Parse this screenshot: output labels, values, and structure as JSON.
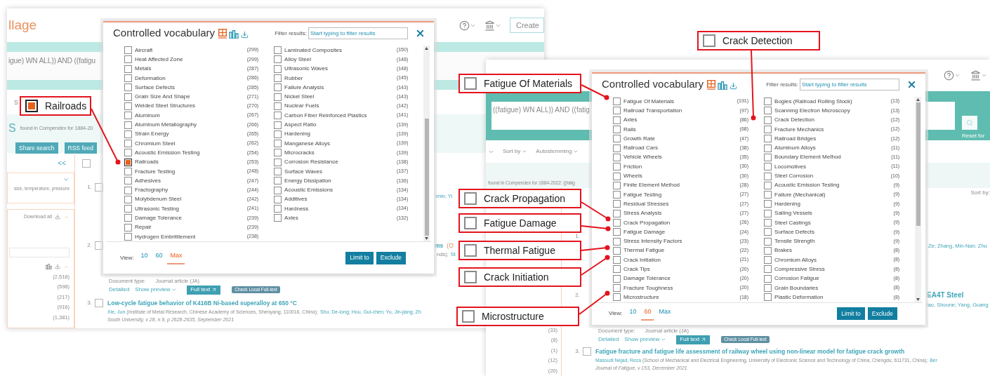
{
  "left_screenshot": {
    "header": {
      "logo": "llage",
      "button": "Create"
    },
    "query": "igue) WN ALL)) AND ((fatigu",
    "sort_fragment": "S",
    "summary": {
      "count": "S",
      "text": "found in Compendex for 1884-20"
    },
    "actions": [
      "Share search",
      "RSS feed"
    ],
    "sidebar": {
      "collapse": "<<",
      "facet_hint": "size, temperature, pressure",
      "download_all": "Download all",
      "counts": [
        "(2,518)",
        "(598)",
        "(217)",
        "(916)",
        "(1,381)"
      ]
    },
    "select_all_checked": false,
    "result1": {
      "number": "1.",
      "checked": false,
      "authors_fragment": "imin; Yi"
    },
    "result2": {
      "number": "2.",
      "checked": false,
      "title_fragment": "ms",
      "title_suffix": "(O",
      "authors_fragment": "nds);",
      "author_link": "St"
    },
    "record": {
      "doc_type_label": "Document type:",
      "doc_type": "Journal article (JA)",
      "detailed": "Detailed",
      "preview": "Show preview",
      "full_text": "Full text",
      "local": "Check Local Full-text"
    },
    "result3": {
      "number": "3.",
      "checked": false,
      "title": "Low-cycle fatigue behavior of K416B Ni-based superalloy at 650 °C",
      "author": "Xie, Jun",
      "affiliation": "(Institute of Metal Research, Chinese Academy of Sciences, Shenyang; 110016, China);",
      "coauthors": "Shu, De-long; Hou, Gui-chen; Yu, Jin-jiang; Zh",
      "source": "South University, v 28, n 9, p 2628-2635, September 2021"
    },
    "dialog": {
      "title": "Controlled vocabulary",
      "filter_label": "Filter results:",
      "filter_placeholder": "Start typing to filter results",
      "columns": [
        {
          "items": [
            {
              "label": "Aircraft",
              "count": "(299)",
              "checked": false
            },
            {
              "label": "Heat Affected Zone",
              "count": "(299)",
              "checked": false
            },
            {
              "label": "Metals",
              "count": "(287)",
              "checked": false
            },
            {
              "label": "Deformation",
              "count": "(286)",
              "checked": false
            },
            {
              "label": "Surface Defects",
              "count": "(285)",
              "checked": false
            },
            {
              "label": "Grain Size And Shape",
              "count": "(271)",
              "checked": false
            },
            {
              "label": "Welded Steel Structures",
              "count": "(270)",
              "checked": false
            },
            {
              "label": "Aluminum",
              "count": "(267)",
              "checked": false
            },
            {
              "label": "Aluminum Metallography",
              "count": "(266)",
              "checked": false
            },
            {
              "label": "Strain Energy",
              "count": "(265)",
              "checked": false
            },
            {
              "label": "Chromium Steel",
              "count": "(262)",
              "checked": false
            },
            {
              "label": "Acoustic Emission Testing",
              "count": "(254)",
              "checked": false
            },
            {
              "label": "Railroads",
              "count": "(253)",
              "checked": true
            },
            {
              "label": "Fracture Testing",
              "count": "(248)",
              "checked": false
            },
            {
              "label": "Adhesives",
              "count": "(247)",
              "checked": false
            },
            {
              "label": "Fractography",
              "count": "(244)",
              "checked": false
            },
            {
              "label": "Molybdenum Steel",
              "count": "(242)",
              "checked": false
            },
            {
              "label": "Ultrasonic Testing",
              "count": "(241)",
              "checked": false
            },
            {
              "label": "Damage Tolerance",
              "count": "(239)",
              "checked": false
            },
            {
              "label": "Repair",
              "count": "(239)",
              "checked": false
            },
            {
              "label": "Hydrogen Embrittlement",
              "count": "(238)",
              "checked": false
            }
          ]
        },
        {
          "items": [
            {
              "label": "Laminated Composites",
              "count": "(150)",
              "checked": false
            },
            {
              "label": "Alloy Steel",
              "count": "(148)",
              "checked": false
            },
            {
              "label": "Ultrasonic Waves",
              "count": "(148)",
              "checked": false
            },
            {
              "label": "Rubber",
              "count": "(145)",
              "checked": false
            },
            {
              "label": "Failure Analysis",
              "count": "(143)",
              "checked": false
            },
            {
              "label": "Nickel Steel",
              "count": "(143)",
              "checked": false
            },
            {
              "label": "Nuclear Fuels",
              "count": "(142)",
              "checked": false
            },
            {
              "label": "Carbon Fiber Reinforced Plastics",
              "count": "(141)",
              "checked": false
            },
            {
              "label": "Aspect Ratio",
              "count": "(139)",
              "checked": false
            },
            {
              "label": "Hardening",
              "count": "(139)",
              "checked": false
            },
            {
              "label": "Manganese Alloys",
              "count": "(139)",
              "checked": false
            },
            {
              "label": "Microcracks",
              "count": "(139)",
              "checked": false
            },
            {
              "label": "Corrosion Resistance",
              "count": "(138)",
              "checked": false
            },
            {
              "label": "Surface Waves",
              "count": "(137)",
              "checked": false
            },
            {
              "label": "Energy Dissipation",
              "count": "(136)",
              "checked": false
            },
            {
              "label": "Acoustic Emissions",
              "count": "(134)",
              "checked": false
            },
            {
              "label": "Additives",
              "count": "(134)",
              "checked": false
            },
            {
              "label": "Hardness",
              "count": "(134)",
              "checked": false
            },
            {
              "label": "Axles",
              "count": "(132)",
              "checked": false
            }
          ]
        }
      ],
      "view": {
        "label": "View:",
        "options": [
          {
            "label": "10",
            "selected": false
          },
          {
            "label": "60",
            "selected": false
          },
          {
            "label": "Max",
            "selected": true
          }
        ]
      },
      "buttons": [
        "Limit to",
        "Exclude"
      ]
    }
  },
  "right_screenshot": {
    "query": "((fatigue) WN ALL)) AND ((fatig",
    "reset": "Reset for",
    "toolbar": [
      "Sort by",
      "Autostemming"
    ],
    "summary": "found in Compendex for 1884-2022: ((fatig",
    "sort_label": "Sort by:",
    "sidebar_counts": [
      "(33)",
      "(8)",
      "(1)",
      "(12)",
      "(20)"
    ],
    "result1": {
      "number": "1.",
      "authors_fragment": "Ze; Zhang, Min-Nan; Zhu"
    },
    "result2": {
      "number": "2.",
      "title_fragment": "EA4T Steel",
      "authors_fragment": "iao, Shoune; Yang, Guang"
    },
    "record": {
      "doc_type_label": "Document type:",
      "doc_type": "Journal article (JA)",
      "detailed": "Detailed",
      "preview": "Show preview",
      "full_text": "Full text",
      "local": "Check Local Full-text"
    },
    "result3": {
      "number": "3.",
      "checked": false,
      "title": "Fatigue fracture and fatigue life assessment of railway wheel using non-linear model for fatigue crack growth",
      "author": "Masoudi Nejad, Reza",
      "affiliation": "(School of Mechanical and Electrical Engineering, University of Electronic Science and Technology of China, Chengdu; 611731, China);",
      "coauthors": "Ber",
      "source": "Journal of Fatigue, v 153, December 2021"
    },
    "dialog": {
      "title": "Controlled vocabulary",
      "filter_label": "Filter results:",
      "filter_placeholder": "Start typing to filter results",
      "columns": [
        {
          "items": [
            {
              "label": "Fatigue Of Materials",
              "count": "(191)",
              "checked": false
            },
            {
              "label": "Railroad Transportation",
              "count": "(97)",
              "checked": false
            },
            {
              "label": "Axles",
              "count": "(86)",
              "checked": false
            },
            {
              "label": "Rails",
              "count": "(68)",
              "checked": false
            },
            {
              "label": "Growth Rate",
              "count": "(47)",
              "checked": false
            },
            {
              "label": "Railroad Cars",
              "count": "(38)",
              "checked": false
            },
            {
              "label": "Vehicle Wheels",
              "count": "(35)",
              "checked": false
            },
            {
              "label": "Friction",
              "count": "(30)",
              "checked": false
            },
            {
              "label": "Wheels",
              "count": "(30)",
              "checked": false
            },
            {
              "label": "Finite Element Method",
              "count": "(28)",
              "checked": false
            },
            {
              "label": "Fatigue Testing",
              "count": "(27)",
              "checked": false
            },
            {
              "label": "Residual Stresses",
              "count": "(27)",
              "checked": false
            },
            {
              "label": "Stress Analysis",
              "count": "(27)",
              "checked": false
            },
            {
              "label": "Crack Propagation",
              "count": "(26)",
              "checked": false
            },
            {
              "label": "Fatigue Damage",
              "count": "(24)",
              "checked": false
            },
            {
              "label": "Stress Intensity Factors",
              "count": "(23)",
              "checked": false
            },
            {
              "label": "Thermal Fatigue",
              "count": "(22)",
              "checked": false
            },
            {
              "label": "Crack Initiation",
              "count": "(21)",
              "checked": false
            },
            {
              "label": "Crack Tips",
              "count": "(20)",
              "checked": false
            },
            {
              "label": "Damage Tolerance",
              "count": "(20)",
              "checked": false
            },
            {
              "label": "Fracture Toughness",
              "count": "(20)",
              "checked": false
            },
            {
              "label": "Microstructure",
              "count": "(18)",
              "checked": false
            }
          ]
        },
        {
          "items": [
            {
              "label": "Bogies (Railroad Rolling Stock)",
              "count": "(13)",
              "checked": false
            },
            {
              "label": "Scanning Electron Microscopy",
              "count": "(13)",
              "checked": false
            },
            {
              "label": "Crack Detection",
              "count": "(12)",
              "checked": false
            },
            {
              "label": "Fracture Mechanics",
              "count": "(12)",
              "checked": false
            },
            {
              "label": "Railroad Bridges",
              "count": "(12)",
              "checked": false
            },
            {
              "label": "Aluminum Alloys",
              "count": "(11)",
              "checked": false
            },
            {
              "label": "Boundary Element Method",
              "count": "(11)",
              "checked": false
            },
            {
              "label": "Locomotives",
              "count": "(11)",
              "checked": false
            },
            {
              "label": "Steel Corrosion",
              "count": "(10)",
              "checked": false
            },
            {
              "label": "Acoustic Emission Testing",
              "count": "(9)",
              "checked": false
            },
            {
              "label": "Failure (Mechanical)",
              "count": "(9)",
              "checked": false
            },
            {
              "label": "Hardening",
              "count": "(9)",
              "checked": false
            },
            {
              "label": "Sailing Vessels",
              "count": "(9)",
              "checked": false
            },
            {
              "label": "Steel Castings",
              "count": "(9)",
              "checked": false
            },
            {
              "label": "Surface Defects",
              "count": "(9)",
              "checked": false
            },
            {
              "label": "Tensile Strength",
              "count": "(9)",
              "checked": false
            },
            {
              "label": "Brakes",
              "count": "(8)",
              "checked": false
            },
            {
              "label": "Chromium Alloys",
              "count": "(8)",
              "checked": false
            },
            {
              "label": "Compressive Stress",
              "count": "(8)",
              "checked": false
            },
            {
              "label": "Corrosion Fatigue",
              "count": "(8)",
              "checked": false
            },
            {
              "label": "Grain Boundaries",
              "count": "(8)",
              "checked": false
            },
            {
              "label": "Plastic Deformation",
              "count": "(8)",
              "checked": false
            }
          ]
        }
      ],
      "view": {
        "label": "View:",
        "options": [
          {
            "label": "10",
            "selected": false
          },
          {
            "label": "60",
            "selected": true
          },
          {
            "label": "Max",
            "selected": false
          }
        ]
      },
      "buttons": [
        "Limit to",
        "Exclude"
      ]
    }
  },
  "callouts": [
    {
      "label": "Railroads",
      "checked": true
    },
    {
      "label": "Crack Detection",
      "checked": false
    },
    {
      "label": "Fatigue Of Materials",
      "checked": false
    },
    {
      "label": "Crack Propagation",
      "checked": false
    },
    {
      "label": "Fatigue Damage",
      "checked": false
    },
    {
      "label": "Thermal Fatigue",
      "checked": false
    },
    {
      "label": "Crack Initiation",
      "checked": false
    },
    {
      "label": "Microstructure",
      "checked": false
    }
  ]
}
